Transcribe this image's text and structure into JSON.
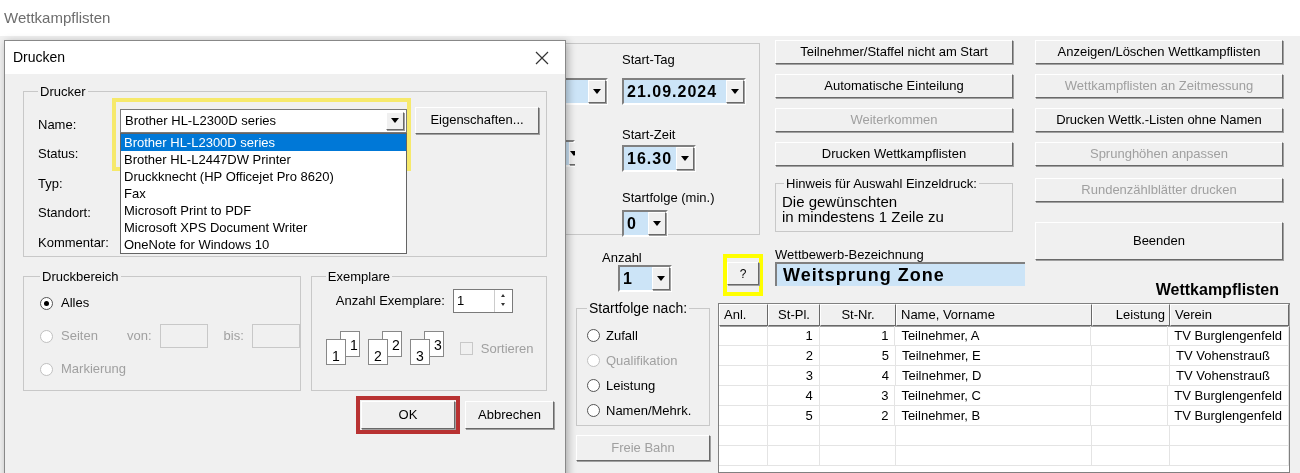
{
  "window": {
    "title": "Wettkampflisten"
  },
  "start_settings": {
    "date_label": "Start-Tag",
    "date": "21.09.2024",
    "time_label": "Start-Zeit",
    "time": "16.30",
    "interval_label": "Startfolge (min.)",
    "interval": "0"
  },
  "count": {
    "label": "Anzahl",
    "value": "1"
  },
  "help_button": "?",
  "actions": [
    {
      "label": "Teilnehmer/Staffel nicht am Start",
      "disabled": false
    },
    {
      "label": "Automatische Einteilung",
      "disabled": false
    },
    {
      "label": "Weiterkommen",
      "disabled": true
    },
    {
      "label": "Drucken Wettkampflisten",
      "disabled": false
    }
  ],
  "hint": {
    "title": "Hinweis für Auswahl Einzeldruck:",
    "lines": [
      "Die gewünschten",
      "in mindestens 1 Zeile zu"
    ]
  },
  "competition": {
    "label": "Wettbewerb-Bezeichnung",
    "value": "Weitsprung Zone"
  },
  "list_actions": [
    {
      "label": "Anzeigen/Löschen Wettkampflisten",
      "disabled": false
    },
    {
      "label": "Wettkampflisten an Zeitmessung",
      "disabled": true
    },
    {
      "label": "Drucken Wettk.-Listen ohne Namen",
      "disabled": false
    },
    {
      "label": "Sprunghöhen anpassen",
      "disabled": true
    },
    {
      "label": "Rundenzählblätter drucken",
      "disabled": true
    }
  ],
  "exit_button": "Beenden",
  "start_order": {
    "title": "Startfolge nach:",
    "options": [
      {
        "label": "Zufall",
        "selected": false,
        "disabled": false
      },
      {
        "label": "Qualifikation",
        "selected": false,
        "disabled": true
      },
      {
        "label": "Leistung",
        "selected": false,
        "disabled": false
      },
      {
        "label": "Namen/Mehrk.",
        "selected": false,
        "disabled": false
      }
    ]
  },
  "free_lane_button": {
    "label": "Freie Bahn",
    "disabled": true
  },
  "table": {
    "title": "Wettkampflisten",
    "columns": [
      "Anl.",
      "St-Pl.",
      "St-Nr.",
      "Name, Vorname",
      "Leistung",
      "Verein"
    ],
    "rows": [
      [
        "",
        "1",
        "1",
        "Teilnehmer, A",
        "",
        "TV Burglengenfeld"
      ],
      [
        "",
        "2",
        "5",
        "Teilnehmer, E",
        "",
        "TV Vohenstrauß"
      ],
      [
        "",
        "3",
        "4",
        "Teilnehmer, D",
        "",
        "TV Vohenstrauß"
      ],
      [
        "",
        "4",
        "3",
        "Teilnehmer, C",
        "",
        "TV Burglengenfeld"
      ],
      [
        "",
        "5",
        "2",
        "Teilnehmer, B",
        "",
        "TV Burglengenfeld"
      ]
    ]
  },
  "dialog": {
    "title": "Drucken",
    "printer": {
      "title": "Drucker",
      "labels": [
        "Name:",
        "Status:",
        "Typ:",
        "Standort:",
        "Kommentar:"
      ],
      "name": "Brother HL-L2300D series",
      "properties_button": "Eigenschaften...",
      "options": [
        {
          "label": "Brother HL-L2300D series",
          "selected": true
        },
        {
          "label": "Brother HL-L2447DW Printer",
          "selected": false
        },
        {
          "label": "Druckknecht (HP Officejet Pro 8620)",
          "selected": false
        },
        {
          "label": "Fax",
          "selected": false
        },
        {
          "label": "Microsoft Print to PDF",
          "selected": false
        },
        {
          "label": "Microsoft XPS Document Writer",
          "selected": false
        },
        {
          "label": "OneNote for Windows 10",
          "selected": false
        }
      ]
    },
    "range": {
      "title": "Druckbereich",
      "options": [
        {
          "label": "Alles",
          "selected": true,
          "disabled": false
        },
        {
          "label": "Seiten",
          "selected": false,
          "disabled": true
        },
        {
          "label": "Markierung",
          "selected": false,
          "disabled": true
        }
      ],
      "from_label": "von:",
      "to_label": "bis:"
    },
    "copies": {
      "title": "Exemplare",
      "label": "Anzahl Exemplare:",
      "value": "1",
      "collate_pages": [
        {
          "back": "1",
          "front": "1"
        },
        {
          "back": "2",
          "front": "2"
        },
        {
          "back": "3",
          "front": "3"
        }
      ],
      "collate": {
        "label": "Sortieren",
        "checked": false,
        "disabled": true
      }
    },
    "ok_button": "OK",
    "cancel_button": "Abbrechen"
  }
}
